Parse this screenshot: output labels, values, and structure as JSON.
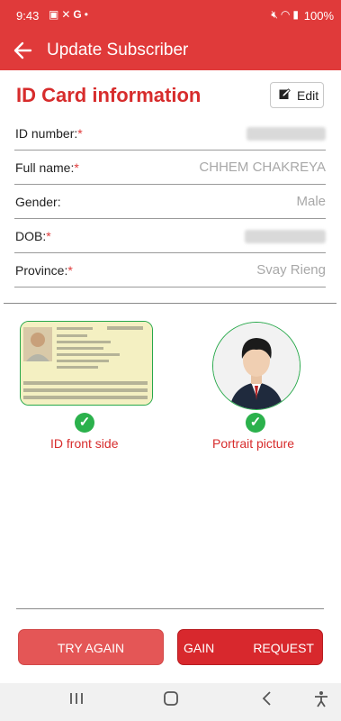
{
  "status_bar": {
    "time": "9:43",
    "left_icons": [
      "gallery-icon",
      "missed-call-icon",
      "google-icon",
      "dot-icon"
    ],
    "right_icons": [
      "mute-icon",
      "wifi-icon",
      "signal-icon"
    ],
    "battery": "100%"
  },
  "app_bar": {
    "back_icon": "back-arrow-icon",
    "title": "Update Subscriber"
  },
  "section": {
    "title": "ID Card information",
    "edit_label": "Edit"
  },
  "fields": [
    {
      "label": "ID number:",
      "required": "*",
      "value": "",
      "redacted": true
    },
    {
      "label": "Full name:",
      "required": "*",
      "value": "CHHEM CHAKREYA",
      "redacted": false
    },
    {
      "label": "Gender:",
      "required": "",
      "value": "Male",
      "redacted": false
    },
    {
      "label": "DOB:",
      "required": "*",
      "value": "",
      "redacted": true
    },
    {
      "label": "Province:",
      "required": "*",
      "value": "Svay Rieng",
      "redacted": false
    }
  ],
  "images": {
    "id_front_caption": "ID front side",
    "portrait_caption": "Portrait picture"
  },
  "buttons": {
    "try_again": "TRY AGAIN",
    "request_ghost": "GAIN",
    "request": "REQUEST"
  },
  "nav_bar": {
    "recents_icon": "recents-icon",
    "home_icon": "home-icon",
    "back_icon": "back-icon",
    "accessibility_icon": "accessibility-icon"
  },
  "colors": {
    "primary": "#e03a3a",
    "title_red": "#d72c2c",
    "success_green": "#2bb14c",
    "value_gray": "#a8a8a8"
  }
}
